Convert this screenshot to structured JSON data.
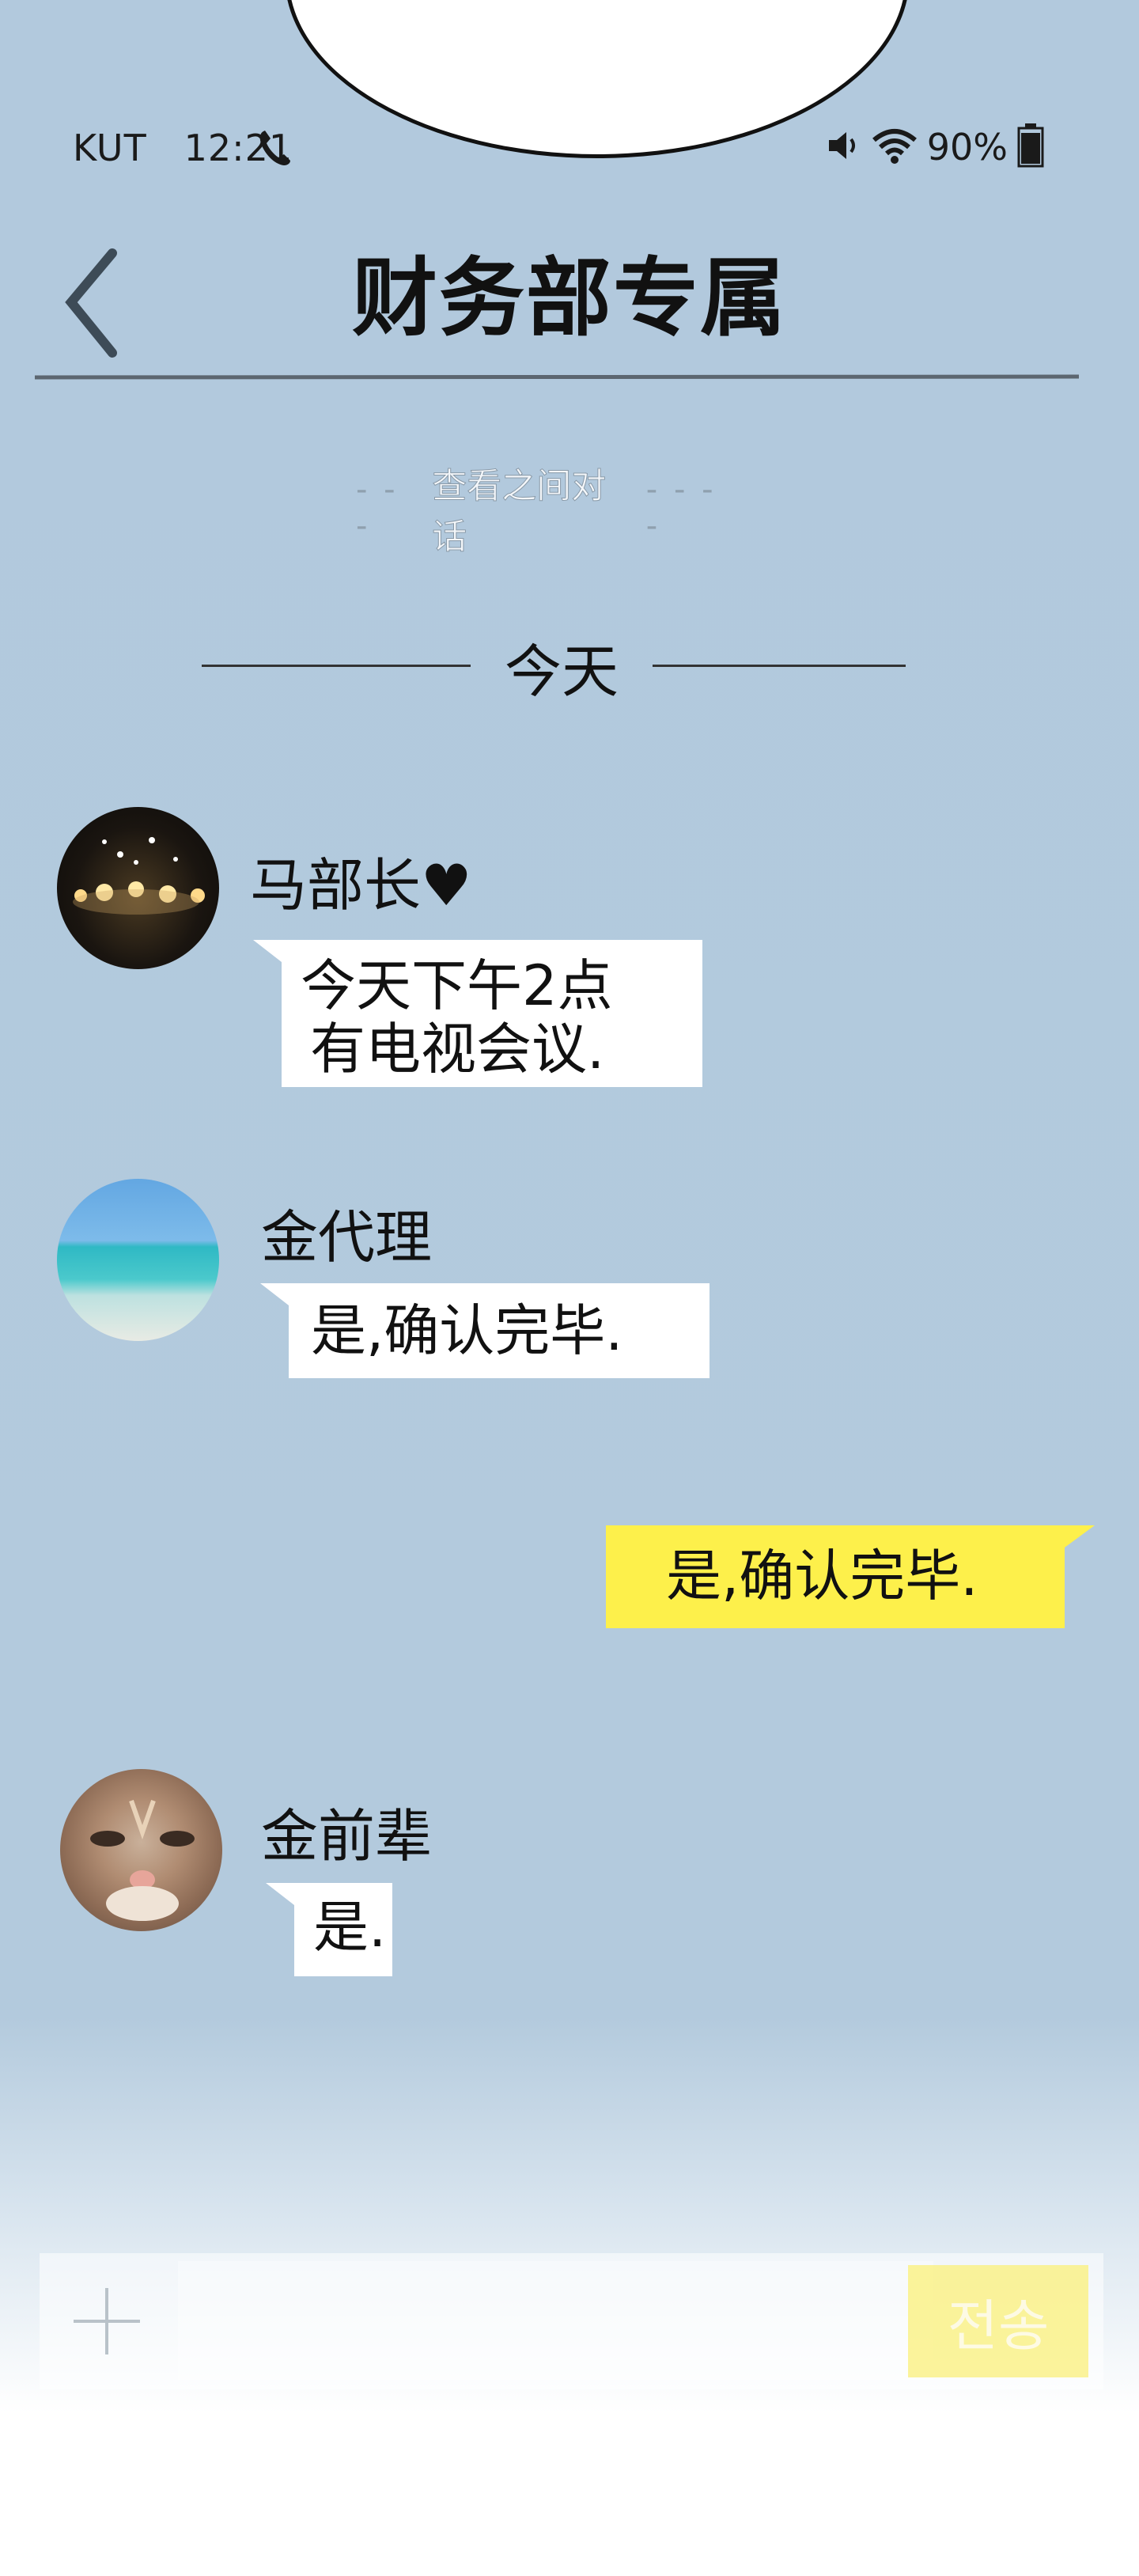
{
  "status_bar": {
    "carrier": "KUT",
    "time": "12:21",
    "battery": "90%",
    "icons": [
      "phone-icon",
      "volume-icon",
      "wifi-icon",
      "battery-icon"
    ]
  },
  "header": {
    "title": "财务部专属",
    "back_icon": "chevron-left-icon"
  },
  "history_link": "查看之间对话",
  "date_separator": "今天",
  "messages": [
    {
      "sender": "马部长♥",
      "text_lines": [
        "今天下午2点",
        "有电视会议."
      ],
      "side": "left",
      "avatar": "candles"
    },
    {
      "sender": "金代理",
      "text_lines": [
        "是,确认完毕."
      ],
      "side": "left",
      "avatar": "sea"
    },
    {
      "sender": "",
      "text_lines": [
        "是,确认完毕."
      ],
      "side": "right"
    },
    {
      "sender": "金前辈",
      "text_lines": [
        "是."
      ],
      "side": "left",
      "avatar": "cat"
    }
  ],
  "input": {
    "placeholder": "",
    "send_label": "전송",
    "plus_icon": "plus-icon"
  },
  "colors": {
    "background": "#b2c9dd",
    "my_bubble": "#fdf04b",
    "their_bubble": "#ffffff",
    "send_button": "#fbf28a"
  }
}
